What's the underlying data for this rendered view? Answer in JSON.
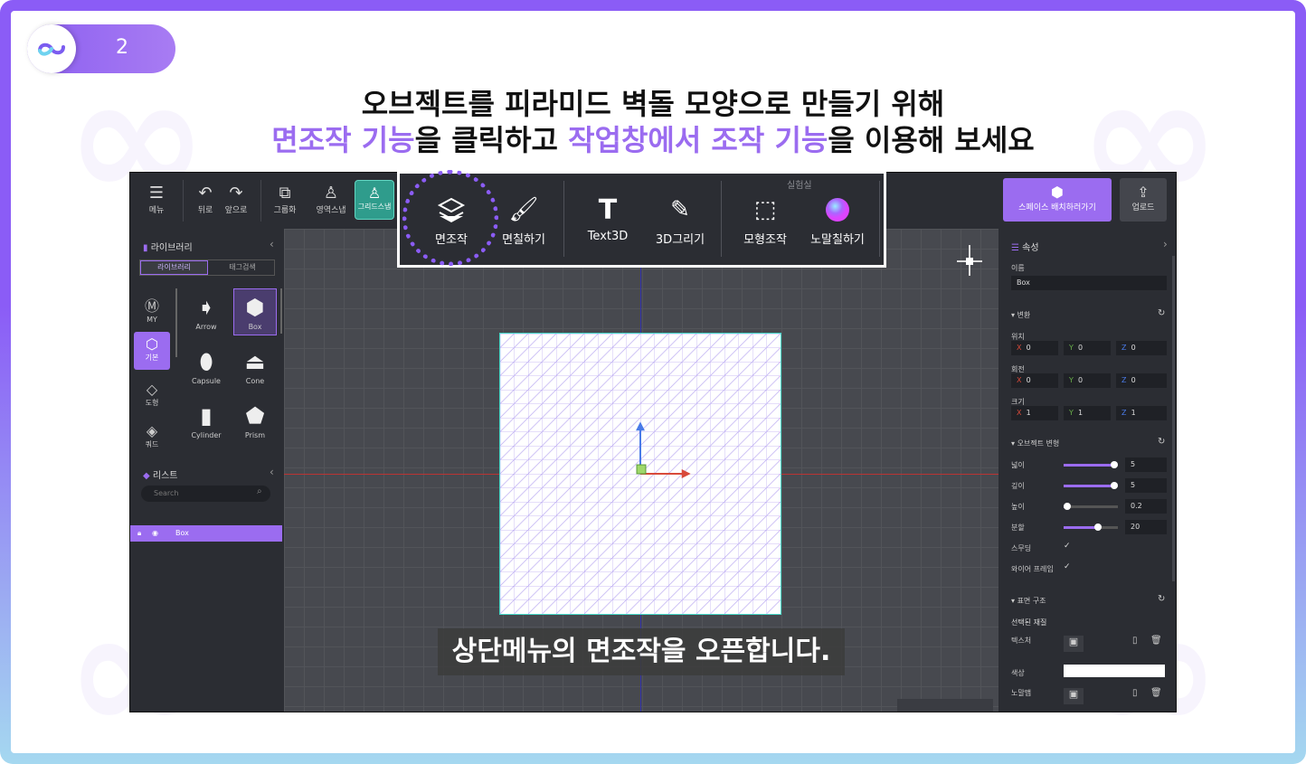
{
  "slide": {
    "number": "2"
  },
  "title": {
    "line1": "오브젝트를 피라미드 벽돌 모양으로 만들기 위해",
    "line2_parts": [
      "면조작 기능",
      "을 클릭하고 ",
      "작업창에서 조작 기능",
      "을 이용해 보세요"
    ]
  },
  "toolbar": {
    "menu": "메뉴",
    "back": "뒤로",
    "forward": "앞으로",
    "group": "그룹화",
    "region_snap": "영역스냅",
    "grid_snap": "그리드스냅",
    "space_place": "스페이스 배치하러가기",
    "upload": "업로드"
  },
  "overlay_toolbar": {
    "lab_label": "실험실",
    "items": [
      "면조작",
      "면칠하기",
      "Text3D",
      "3D그리기",
      "모형조작",
      "노말칠하기"
    ]
  },
  "library": {
    "title": "라이브러리",
    "tabs": [
      "라이브러리",
      "태그검색"
    ],
    "categories": [
      "MY",
      "기본",
      "도형",
      "쿼드"
    ],
    "shapes": [
      "Arrow",
      "Box",
      "Capsule",
      "Cone",
      "Cylinder",
      "Prism"
    ]
  },
  "list": {
    "title": "리스트",
    "search_placeholder": "Search",
    "items": [
      "Box"
    ]
  },
  "viewport": {
    "caption": "상단메뉴의 면조작을 오픈합니다."
  },
  "properties": {
    "title": "속성",
    "name_label": "이름",
    "name_value": "Box",
    "transform": "변환",
    "position": "위치",
    "rotation": "회전",
    "scale": "크기",
    "pos": [
      "0",
      "0",
      "0"
    ],
    "rot": [
      "0",
      "0",
      "0"
    ],
    "scl": [
      "1",
      "1",
      "1"
    ],
    "deform": "오브젝트 변형",
    "width_label": "넓이",
    "width_value": "5",
    "depth_label": "깊이",
    "depth_value": "5",
    "height_label": "높이",
    "height_value": "0.2",
    "divide_label": "분할",
    "divide_value": "20",
    "smoothing": "스무딩",
    "wireframe": "와이어 프레임",
    "surface": "표면 구조",
    "selected_material": "선택된 재질",
    "texture": "텍스처",
    "color": "색상",
    "normal_map": "노말맵"
  }
}
